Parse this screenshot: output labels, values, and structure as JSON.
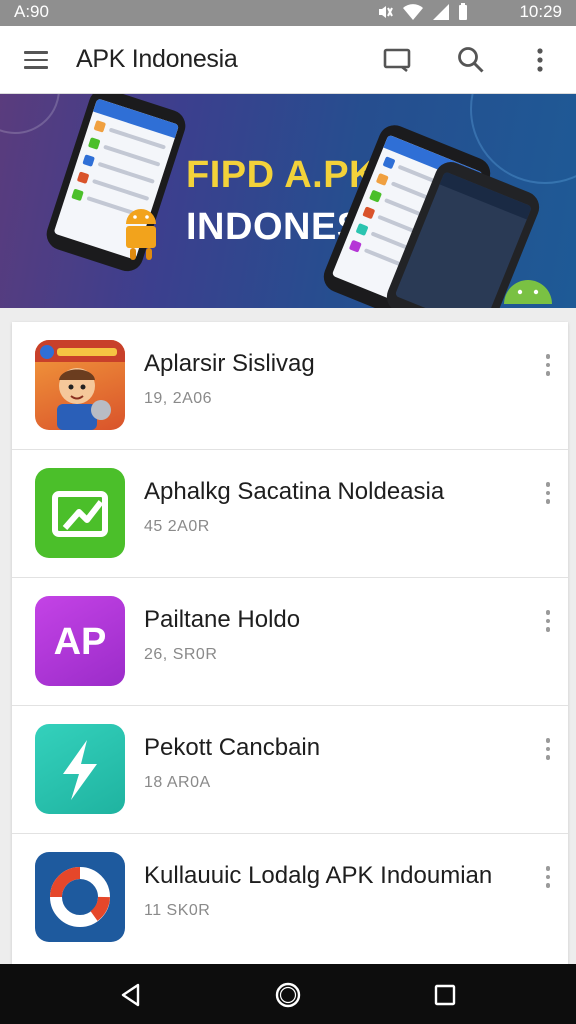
{
  "status_bar": {
    "time_left": "A:90",
    "time_right": "10:29",
    "icons": [
      "mute-icon",
      "wifi-icon",
      "signal-icon",
      "battery-icon"
    ]
  },
  "app_bar": {
    "title": "APK Indonesia",
    "icons": [
      "menu-icon",
      "cast-icon",
      "search-icon",
      "more-vert-icon"
    ]
  },
  "banner": {
    "line1": "FIPD A.PK",
    "line2": "INDONESIA",
    "colors": {
      "line1": "#f3d23a",
      "line2": "#ffffff"
    }
  },
  "apps": [
    {
      "name": "Aplarsir Sislivag",
      "meta": "19, 2A06",
      "icon": "game-character-icon",
      "color": "#d9532b"
    },
    {
      "name": "Aphalkg Sacatina Noldeasia",
      "meta": "45 2A0R",
      "icon": "green-chart-icon",
      "color": "#4bbf2a"
    },
    {
      "name": "Pailtane Holdo",
      "meta": "26, SR0R",
      "icon": "ap-logo-icon",
      "color": "#b536d6"
    },
    {
      "name": "Pekott Cancbain",
      "meta": "18 AR0A",
      "icon": "lightning-icon",
      "color": "#2bc4b0"
    },
    {
      "name": "Kullauuic Lodalg APK Indoumian",
      "meta": "11 SK0R",
      "icon": "ring-logo-icon",
      "color": "#1e5a9e"
    }
  ],
  "nav_bar": {
    "icons": [
      "back-icon",
      "home-icon",
      "recents-icon"
    ]
  }
}
